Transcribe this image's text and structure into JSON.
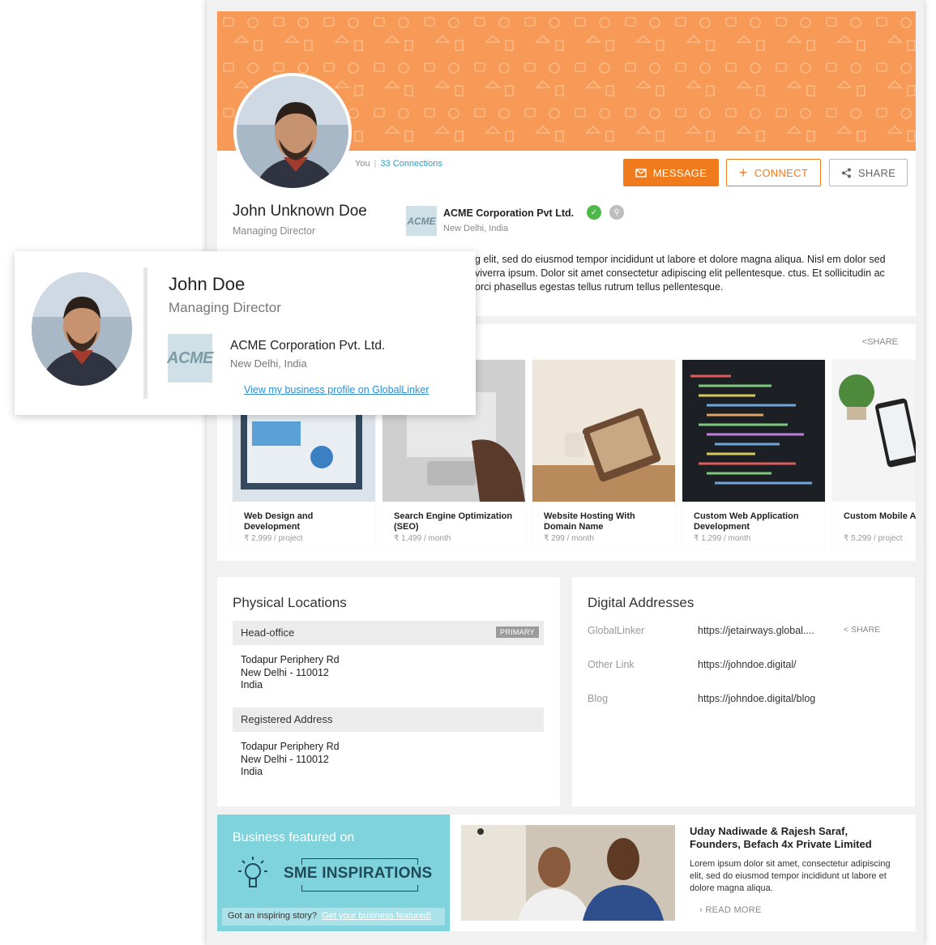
{
  "profile": {
    "you_label": "You",
    "connections": "33 Connections",
    "name": "John Unknown Doe",
    "title": "Managing Director",
    "company": "ACME Corporation Pvt Ltd.",
    "company_location": "New Delhi, India",
    "logo_text": "ACME",
    "about": "g elit, sed do eiusmod tempor incididunt ut labore et dolore magna aliqua. Nisl em dolor sed viverra ipsum. Dolor sit amet consectetur adipiscing elit pellentesque. ctus. Et sollicitudin ac orci phasellus egestas tellus rutrum tellus pellentesque."
  },
  "actions": {
    "message": "MESSAGE",
    "connect": "CONNECT",
    "share": "SHARE"
  },
  "products": {
    "share": "SHARE",
    "items": [
      {
        "name": "Web Design and Development",
        "price": "₹ 2,999 / project"
      },
      {
        "name": "Search Engine Optimization (SEO)",
        "price": "₹ 1,499 / month"
      },
      {
        "name": "Website Hosting With Domain Name",
        "price": "₹ 299 / month"
      },
      {
        "name": "Custom Web Application Development",
        "price": "₹ 1,299 / month"
      },
      {
        "name": "Custom Mobile A (Android, iOS) De",
        "price": "₹ 5,299 / project"
      }
    ]
  },
  "locations": {
    "title": "Physical Locations",
    "head_office": {
      "label": "Head-office",
      "tag": "PRIMARY",
      "line1": "Todapur Periphery Rd",
      "line2": "New Delhi - 110012",
      "line3": "India"
    },
    "registered": {
      "label": "Registered Address",
      "line1": "Todapur Periphery Rd",
      "line2": "New Delhi - 110012",
      "line3": "India"
    }
  },
  "digital": {
    "title": "Digital Addresses",
    "rows": [
      {
        "label": "GlobalLinker",
        "value": "https://jetairways.global....",
        "share": "SHARE"
      },
      {
        "label": "Other Link",
        "value": "https://johndoe.digital/"
      },
      {
        "label": "Blog",
        "value": "https://johndoe.digital/blog"
      }
    ]
  },
  "feature": {
    "title": "Business featured on",
    "brand": "SME INSPIRATIONS",
    "story_prompt": "Got an inspiring story?",
    "story_link": "Get your business featured!",
    "people": "Uday Nadiwade & Rajesh Saraf, Founders, Befach 4x Private Limited",
    "desc": "Lorem ipsum dolor sit amet, consectetur adipiscing elit, sed do eiusmod tempor incididunt ut labore et dolore magna aliqua.",
    "read_more": "READ MORE"
  },
  "overlay": {
    "name": "John Doe",
    "title": "Managing Director",
    "logo_text": "ACME",
    "company": "ACME Corporation Pvt. Ltd.",
    "location": "New Delhi, India",
    "link": "View my business profile on GlobalLinker"
  },
  "colors": {
    "cover": "#f79a57",
    "accent": "#f07b1d",
    "link": "#29a0c5",
    "feature_bg": "#7fd3dd"
  }
}
